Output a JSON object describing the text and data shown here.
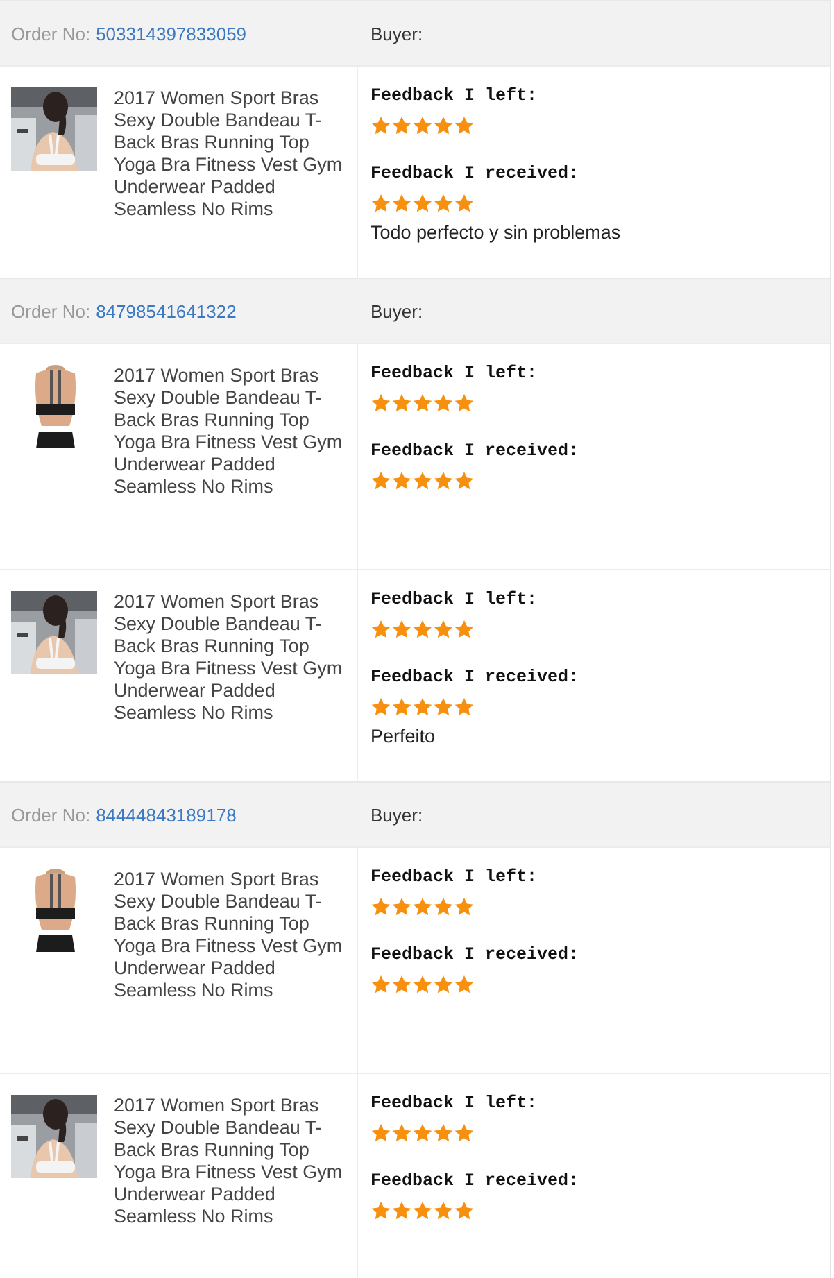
{
  "orders": [
    {
      "order_label": "Order No:",
      "order_number": "503314397833059",
      "buyer_label": "Buyer:",
      "items": [
        {
          "title": "2017 Women Sport Bras Sexy Double Bandeau T-Back Bras Running Top Yoga Bra Fitness Vest Gym Underwear Padded Seamless No Rims",
          "feedback_left": {
            "label": "Feedback I left:",
            "stars": 5
          },
          "feedback_received": {
            "label": "Feedback I received:",
            "stars": 5
          },
          "comment": "Todo perfecto y sin problemas"
        }
      ]
    },
    {
      "order_label": "Order No:",
      "order_number": "84798541641322",
      "buyer_label": "Buyer:",
      "items": [
        {
          "title": "2017 Women Sport Bras Sexy Double Bandeau T-Back Bras Running Top Yoga Bra Fitness Vest Gym Underwear Padded Seamless No Rims",
          "feedback_left": {
            "label": "Feedback I left:",
            "stars": 5
          },
          "feedback_received": {
            "label": "Feedback I received:",
            "stars": 5
          }
        },
        {
          "title": "2017 Women Sport Bras Sexy Double Bandeau T-Back Bras Running Top Yoga Bra Fitness Vest Gym Underwear Padded Seamless No Rims",
          "feedback_left": {
            "label": "Feedback I left:",
            "stars": 5
          },
          "feedback_received": {
            "label": "Feedback I received:",
            "stars": 5
          },
          "comment": "Perfeito"
        }
      ]
    },
    {
      "order_label": "Order No:",
      "order_number": "84444843189178",
      "buyer_label": "Buyer:",
      "items": [
        {
          "title": "2017 Women Sport Bras Sexy Double Bandeau T-Back Bras Running Top Yoga Bra Fitness Vest Gym Underwear Padded Seamless No Rims",
          "feedback_left": {
            "label": "Feedback I left:",
            "stars": 5
          },
          "feedback_received": {
            "label": "Feedback I received:",
            "stars": 5
          }
        },
        {
          "title": "2017 Women Sport Bras Sexy Double Bandeau T-Back Bras Running Top Yoga Bra Fitness Vest Gym Underwear Padded Seamless No Rims",
          "feedback_left": {
            "label": "Feedback I left:",
            "stars": 5
          },
          "feedback_received": {
            "label": "Feedback I received:",
            "stars": 5
          }
        }
      ]
    }
  ]
}
